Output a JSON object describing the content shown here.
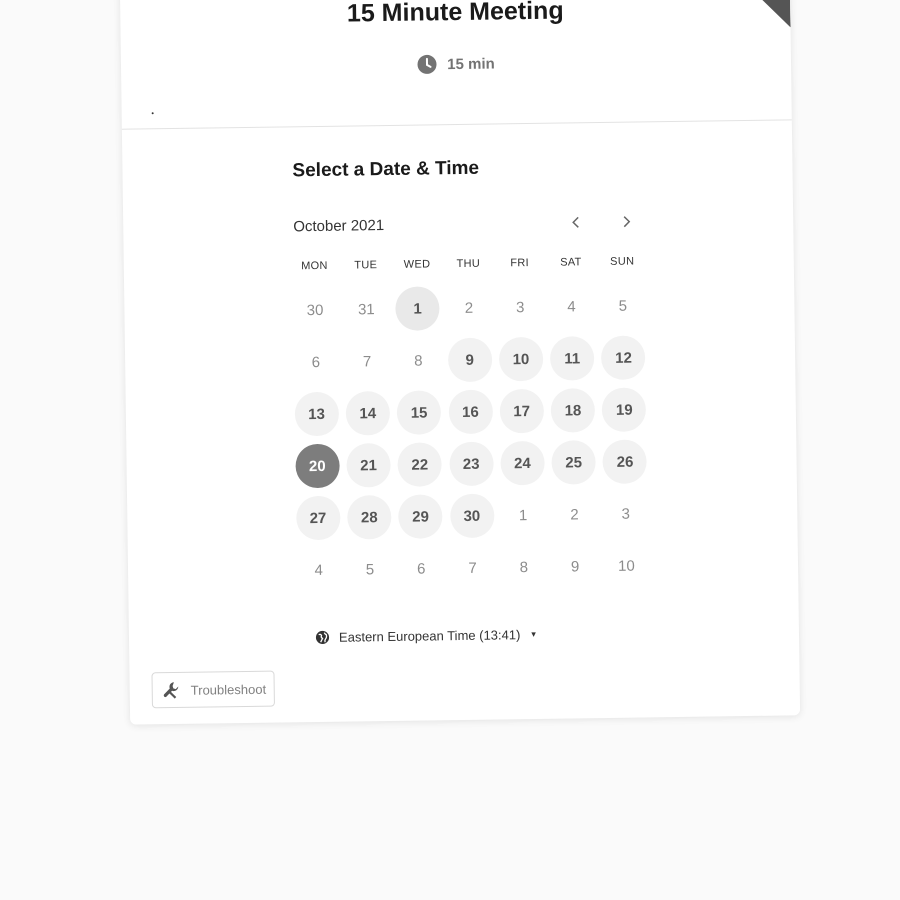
{
  "event": {
    "title": "15 Minute Meeting",
    "duration": "15 min",
    "clock_icon": "clock-icon"
  },
  "scheduler": {
    "heading": "Select a Date & Time",
    "month": "October 2021",
    "prev_icon": "chevron-left-icon",
    "next_icon": "chevron-right-icon",
    "weekdays": [
      "MON",
      "TUE",
      "WED",
      "THU",
      "FRI",
      "SAT",
      "SUN"
    ],
    "days": [
      {
        "label": "30",
        "state": "outside"
      },
      {
        "label": "31",
        "state": "outside"
      },
      {
        "label": "1",
        "state": "today"
      },
      {
        "label": "2",
        "state": "unavailable"
      },
      {
        "label": "3",
        "state": "unavailable"
      },
      {
        "label": "4",
        "state": "unavailable"
      },
      {
        "label": "5",
        "state": "unavailable"
      },
      {
        "label": "6",
        "state": "unavailable"
      },
      {
        "label": "7",
        "state": "unavailable"
      },
      {
        "label": "8",
        "state": "unavailable"
      },
      {
        "label": "9",
        "state": "available"
      },
      {
        "label": "10",
        "state": "available"
      },
      {
        "label": "11",
        "state": "available"
      },
      {
        "label": "12",
        "state": "available"
      },
      {
        "label": "13",
        "state": "available"
      },
      {
        "label": "14",
        "state": "available"
      },
      {
        "label": "15",
        "state": "available"
      },
      {
        "label": "16",
        "state": "available"
      },
      {
        "label": "17",
        "state": "available"
      },
      {
        "label": "18",
        "state": "available"
      },
      {
        "label": "19",
        "state": "available"
      },
      {
        "label": "20",
        "state": "selected"
      },
      {
        "label": "21",
        "state": "available"
      },
      {
        "label": "22",
        "state": "available"
      },
      {
        "label": "23",
        "state": "available"
      },
      {
        "label": "24",
        "state": "available"
      },
      {
        "label": "25",
        "state": "available"
      },
      {
        "label": "26",
        "state": "available"
      },
      {
        "label": "27",
        "state": "available"
      },
      {
        "label": "28",
        "state": "available"
      },
      {
        "label": "29",
        "state": "available"
      },
      {
        "label": "30",
        "state": "available"
      },
      {
        "label": "1",
        "state": "outside"
      },
      {
        "label": "2",
        "state": "outside"
      },
      {
        "label": "3",
        "state": "outside"
      },
      {
        "label": "4",
        "state": "outside"
      },
      {
        "label": "5",
        "state": "outside"
      },
      {
        "label": "6",
        "state": "outside"
      },
      {
        "label": "7",
        "state": "outside"
      },
      {
        "label": "8",
        "state": "outside"
      },
      {
        "label": "9",
        "state": "outside"
      },
      {
        "label": "10",
        "state": "outside"
      }
    ]
  },
  "timezone": {
    "label": "Eastern European Time (13:41)",
    "icon": "globe-icon",
    "caret": "▾"
  },
  "troubleshoot": {
    "label": "Troubleshoot",
    "icon": "wrench-icon"
  },
  "colors": {
    "selected": "#7d7d7d",
    "available_bg": "#f2f2f2",
    "ribbon": "#555555"
  }
}
